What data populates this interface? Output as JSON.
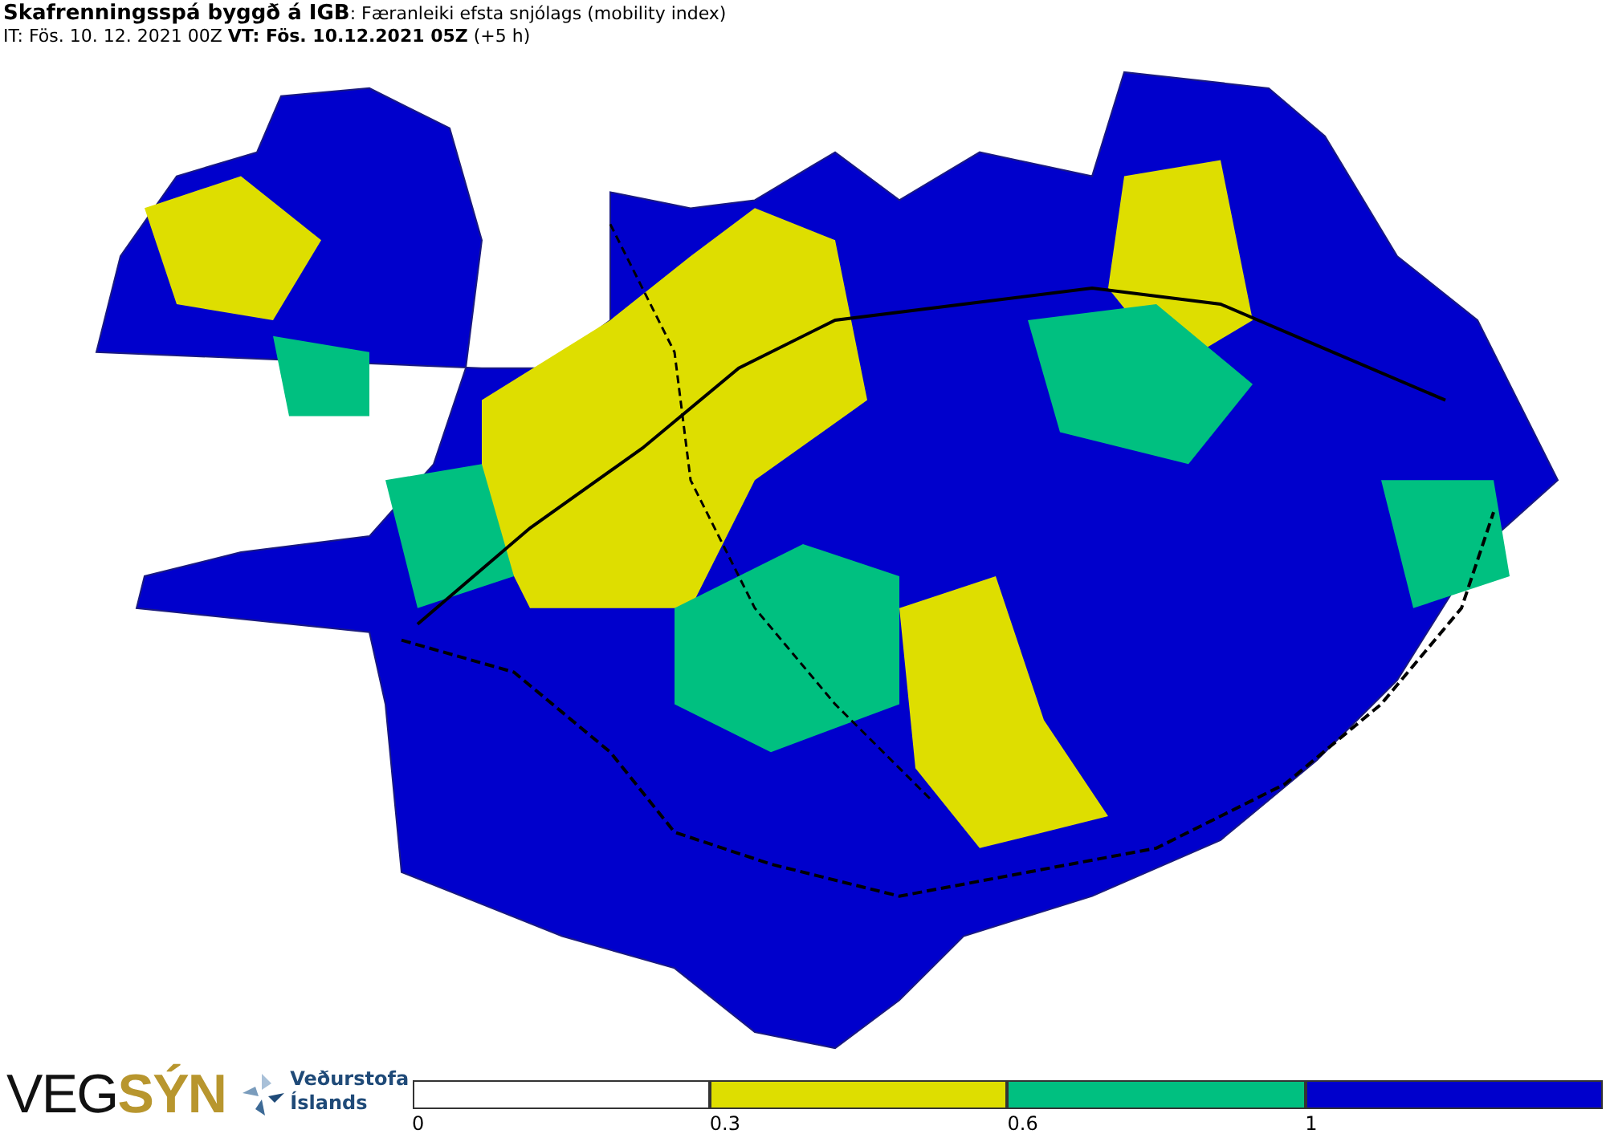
{
  "header": {
    "title": "**Skafrenningsspá byggð á IGB**: Færanleiki efsta snjólags (mobility index)",
    "subtitle": "IT: Fös. 10. 12. 2021 00Z **VT: Fös. 10.12.2021 05Z** (+5 h)"
  },
  "logos": {
    "vegsyn": "VEG**SÝN**",
    "vedurstofa": [
      "Veðurstofa",
      "Íslands"
    ]
  },
  "legend": {
    "segments": [
      {
        "color": "#ffffff",
        "tick": "0"
      },
      {
        "color": "#dede00",
        "tick": "0.3"
      },
      {
        "color": "#00c080",
        "tick": "0.6"
      },
      {
        "color": "#0000cc",
        "tick": "1"
      }
    ]
  }
}
